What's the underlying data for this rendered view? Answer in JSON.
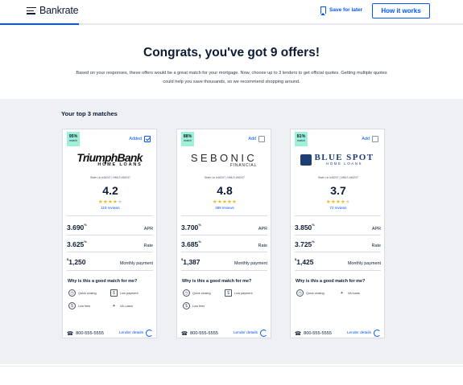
{
  "header": {
    "logo": "Bankrate",
    "save_later": "Save for later",
    "how_it_works": "How it works",
    "progress_fraction": 0.17
  },
  "intro": {
    "title": "Congrats, you've got 9 offers!",
    "subtitle": "Based on your responses, these offers would be a great match for your mortgage. Now, choose up to 3 lenders to get official quotes. Getting multiple quotes could help you save thousands, so we recommend shopping around."
  },
  "matches": {
    "title": "Your top 3 matches",
    "why_label": "Why is this a good match for me?",
    "apr_label": "APR",
    "rate_label": "Rate",
    "payment_label": "Monthly payment",
    "lender_details": "Lender details",
    "cards": [
      {
        "match_pct": "95%",
        "match_label": "match",
        "add_label": "Added",
        "selected": true,
        "logo_line1": "TriumphBank",
        "logo_line2": "HOME LOANS",
        "license": "State Lic #46247  |  NMLS #46247",
        "rating": "4.2",
        "stars": 4,
        "reviews": "119 reviews",
        "apr": "3.690",
        "rate": "3.625",
        "payment": "1,250",
        "features": [
          "Quick closing",
          "Low payment",
          "Low fees",
          "VA Loans"
        ],
        "phone": "800-555-5555"
      },
      {
        "match_pct": "88%",
        "match_label": "match",
        "add_label": "Add",
        "selected": false,
        "logo_line1": "SEBONIC",
        "logo_line2": "FINANCIAL",
        "license": "State Lic #46247  |  NMLS #46247",
        "rating": "4.8",
        "stars": 5,
        "reviews": "389 reviews",
        "apr": "3.700",
        "rate": "3.685",
        "payment": "1,387",
        "features": [
          "Quick closing",
          "Low payment",
          "Low fees"
        ],
        "phone": "800-555-5555"
      },
      {
        "match_pct": "81%",
        "match_label": "match",
        "add_label": "Add",
        "selected": false,
        "logo_line1": "BLUE SPOT",
        "logo_line2": "HOME LOANS",
        "license": "State Lic #46247  |  NMLS #46247",
        "rating": "3.7",
        "stars": 4,
        "reviews": "72 reviews",
        "apr": "3.850",
        "rate": "3.725",
        "payment": "1,425",
        "features": [
          "Quick closing",
          "VA loans"
        ],
        "phone": "800-555-5555"
      }
    ]
  },
  "colors": {
    "accent": "#0157ff",
    "match_badge": "#9ef0d8",
    "star": "#f4b81c",
    "section_bg": "#eef0f4"
  }
}
